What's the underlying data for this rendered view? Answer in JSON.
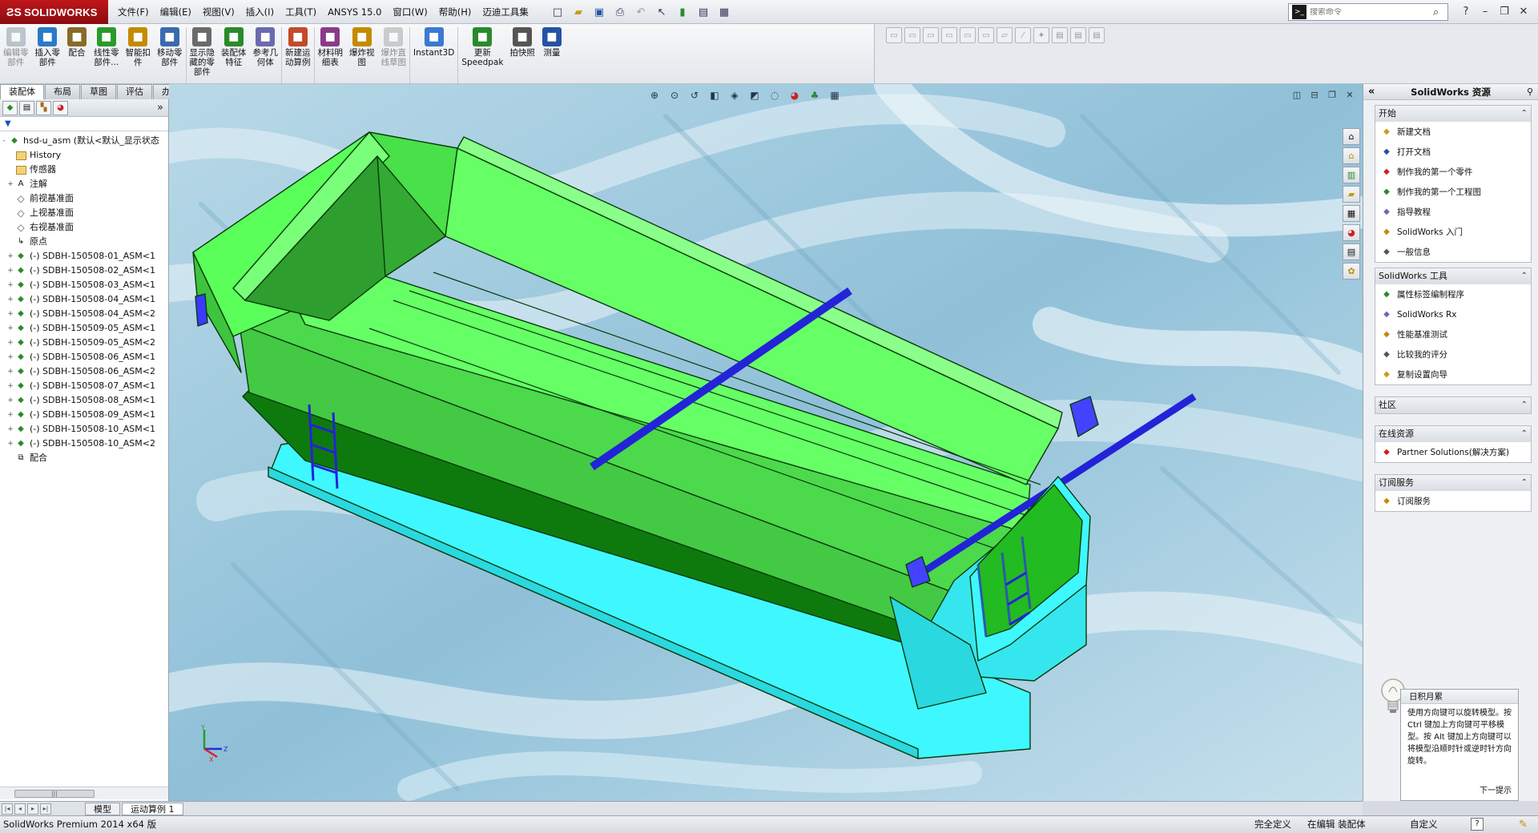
{
  "app": {
    "logo": "SOLIDWORKS",
    "menus": [
      "文件(F)",
      "编辑(E)",
      "视图(V)",
      "插入(I)",
      "工具(T)",
      "ANSYS 15.0",
      "窗口(W)",
      "帮助(H)",
      "迈迪工具集"
    ],
    "search_placeholder": "搜索命令",
    "colors": {
      "brand": "#c0161b",
      "model_green": "#66ff66",
      "model_cyan": "#3ff7ff",
      "accent_blue": "#2a2ad0"
    }
  },
  "toolbar": {
    "buttons": [
      {
        "label": "编辑零\n部件",
        "icon": "edit-component-icon",
        "disabled": true
      },
      {
        "label": "插入零\n部件",
        "icon": "insert-component-icon"
      },
      {
        "label": "配合",
        "icon": "mate-icon"
      },
      {
        "label": "线性零\n部件...",
        "icon": "linear-pattern-icon"
      },
      {
        "label": "智能扣\n件",
        "icon": "smart-fastener-icon"
      },
      {
        "label": "移动零\n部件",
        "icon": "move-component-icon"
      },
      {
        "label": "显示隐\n藏的零\n部件",
        "icon": "show-hidden-icon"
      },
      {
        "label": "装配体\n特征",
        "icon": "assembly-feature-icon"
      },
      {
        "label": "参考几\n何体",
        "icon": "reference-geometry-icon"
      },
      {
        "label": "新建运\n动算例",
        "icon": "new-motion-study-icon"
      },
      {
        "label": "材料明\n细表",
        "icon": "bom-icon"
      },
      {
        "label": "爆炸视\n图",
        "icon": "exploded-view-icon"
      },
      {
        "label": "爆炸直\n线草图",
        "icon": "explode-line-icon",
        "disabled": true
      },
      {
        "label": "Instant3D",
        "icon": "instant3d-icon"
      },
      {
        "label": "更新\nSpeedpak",
        "icon": "speedpak-icon"
      },
      {
        "label": "拍快照",
        "icon": "snapshot-icon"
      },
      {
        "label": "测量",
        "icon": "measure-icon"
      }
    ]
  },
  "tabs": [
    "装配体",
    "布局",
    "草图",
    "评估",
    "办公室产品"
  ],
  "tree": {
    "root": "hsd-u_asm  (默认<默认_显示状态",
    "items": [
      {
        "label": "History",
        "kind": "hist",
        "exp": ""
      },
      {
        "label": "传感器",
        "kind": "folder",
        "exp": ""
      },
      {
        "label": "注解",
        "kind": "anno",
        "exp": "+"
      },
      {
        "label": "前视基准面",
        "kind": "plane",
        "exp": ""
      },
      {
        "label": "上视基准面",
        "kind": "plane",
        "exp": ""
      },
      {
        "label": "右视基准面",
        "kind": "plane",
        "exp": ""
      },
      {
        "label": "原点",
        "kind": "origin",
        "exp": ""
      },
      {
        "label": "(-) SDBH-150508-01_ASM<1",
        "kind": "asm",
        "exp": "+"
      },
      {
        "label": "(-) SDBH-150508-02_ASM<1",
        "kind": "asm",
        "exp": "+"
      },
      {
        "label": "(-) SDBH-150508-03_ASM<1",
        "kind": "asm",
        "exp": "+"
      },
      {
        "label": "(-) SDBH-150508-04_ASM<1",
        "kind": "asm",
        "exp": "+"
      },
      {
        "label": "(-) SDBH-150508-04_ASM<2",
        "kind": "asm",
        "exp": "+"
      },
      {
        "label": "(-) SDBH-150509-05_ASM<1",
        "kind": "asm",
        "exp": "+"
      },
      {
        "label": "(-) SDBH-150509-05_ASM<2",
        "kind": "asm",
        "exp": "+"
      },
      {
        "label": "(-) SDBH-150508-06_ASM<1",
        "kind": "asm",
        "exp": "+"
      },
      {
        "label": "(-) SDBH-150508-06_ASM<2",
        "kind": "asm",
        "exp": "+"
      },
      {
        "label": "(-) SDBH-150508-07_ASM<1",
        "kind": "asm",
        "exp": "+"
      },
      {
        "label": "(-) SDBH-150508-08_ASM<1",
        "kind": "asm",
        "exp": "+"
      },
      {
        "label": "(-) SDBH-150508-09_ASM<1",
        "kind": "asm",
        "exp": "+"
      },
      {
        "label": "(-) SDBH-150508-10_ASM<1",
        "kind": "asm",
        "exp": "+"
      },
      {
        "label": "(-) SDBH-150508-10_ASM<2",
        "kind": "asm",
        "exp": "+"
      },
      {
        "label": "配合",
        "kind": "mates",
        "exp": ""
      }
    ]
  },
  "taskpane": {
    "title": "SolidWorks 资源",
    "groups": [
      {
        "title": "开始",
        "items": [
          {
            "label": "新建文档",
            "icon": "new-doc-icon"
          },
          {
            "label": "打开文档",
            "icon": "open-doc-icon"
          },
          {
            "label": "制作我的第一个零件",
            "icon": "tutorial-part-icon"
          },
          {
            "label": "制作我的第一个工程图",
            "icon": "tutorial-drawing-icon"
          },
          {
            "label": "指导教程",
            "icon": "tutorial-icon"
          },
          {
            "label": "SolidWorks 入门",
            "icon": "intro-icon"
          },
          {
            "label": "一般信息",
            "icon": "info-icon"
          }
        ]
      },
      {
        "title": "SolidWorks 工具",
        "items": [
          {
            "label": "属性标签编制程序",
            "icon": "property-tab-icon"
          },
          {
            "label": "SolidWorks Rx",
            "icon": "rx-icon"
          },
          {
            "label": "性能基准测试",
            "icon": "benchmark-icon"
          },
          {
            "label": "比较我的评分",
            "icon": "compare-score-icon"
          },
          {
            "label": "复制设置向导",
            "icon": "copy-settings-icon"
          }
        ]
      },
      {
        "title": "社区",
        "items": []
      },
      {
        "title": "在线资源",
        "items": [
          {
            "label": "Partner Solutions(解决方案)",
            "icon": "partner-icon"
          }
        ]
      },
      {
        "title": "订阅服务",
        "items": [
          {
            "label": "订阅服务",
            "icon": "subscription-icon"
          }
        ]
      }
    ]
  },
  "tip": {
    "title": "日积月累",
    "body": "使用方向键可以旋转模型。按 Ctrl 键加上方向键可平移模型。按 Alt 键加上方向键可以将模型沿顺时针或逆时针方向旋转。",
    "next": "下一提示"
  },
  "bottom_tabs": [
    "模型",
    "运动算例 1"
  ],
  "status": {
    "product": "SolidWorks Premium 2014 x64 版",
    "definition": "完全定义",
    "editing": "在编辑 装配体",
    "units": "自定义",
    "help": "?"
  },
  "triad": {
    "x": "X",
    "y": "Y",
    "z": "Z"
  }
}
